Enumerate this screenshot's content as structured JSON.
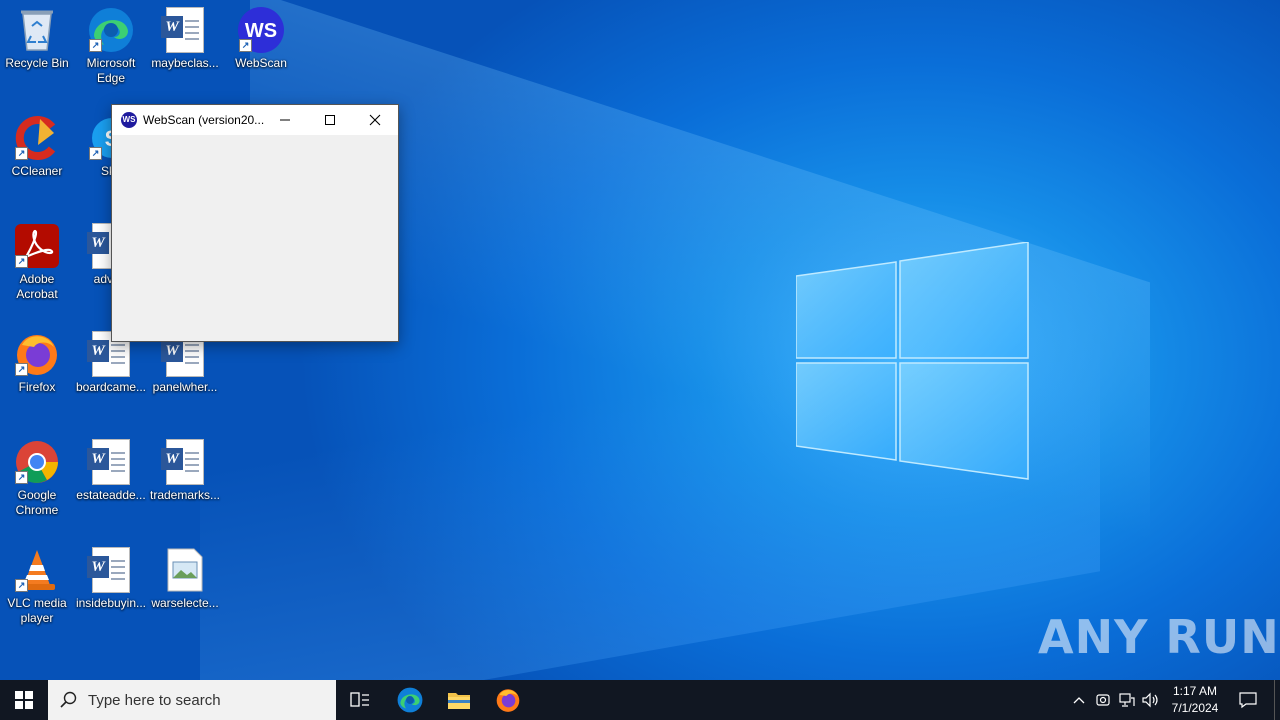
{
  "desktop": {
    "icons": [
      {
        "label": "Recycle Bin"
      },
      {
        "label": "Microsoft Edge"
      },
      {
        "label": "maybeclas..."
      },
      {
        "label": "WebScan"
      },
      {
        "label": "CCleaner"
      },
      {
        "label": "Sky"
      },
      {
        "label": "Adobe Acrobat"
      },
      {
        "label": "advice"
      },
      {
        "label": "Firefox"
      },
      {
        "label": "boardcame..."
      },
      {
        "label": "panelwher..."
      },
      {
        "label": "Google Chrome"
      },
      {
        "label": "estateadde..."
      },
      {
        "label": "trademarks..."
      },
      {
        "label": "VLC media player"
      },
      {
        "label": "insidebuyin..."
      },
      {
        "label": "warselecte..."
      }
    ],
    "watermark": "ANY RUN"
  },
  "window": {
    "title": "WebScan (version20...",
    "app_icon_text": "WS"
  },
  "taskbar": {
    "search_placeholder": "Type here to search",
    "time": "1:17 AM",
    "date": "7/1/2024"
  },
  "colors": {
    "accent": "#0a6ed8",
    "taskbar": "#111722",
    "word_blue": "#2b579a"
  }
}
